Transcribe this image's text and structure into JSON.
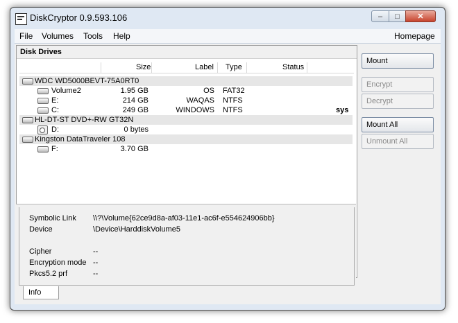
{
  "window": {
    "title": "DiskCryptor 0.9.593.106",
    "controls": {
      "minimize": "–",
      "maximize": "□",
      "close": "✕"
    }
  },
  "menu": {
    "items": [
      "File",
      "Volumes",
      "Tools",
      "Help"
    ],
    "homepage": "Homepage"
  },
  "drives": {
    "title": "Disk Drives",
    "columns": {
      "name": "",
      "size": "Size",
      "label": "Label",
      "type": "Type",
      "status": "Status"
    },
    "rows": [
      {
        "kind": "device",
        "icon": "hard-disk-icon",
        "name": "WDC WD5000BEVT-75A0RT0",
        "size": "",
        "label": "",
        "type": "",
        "status": ""
      },
      {
        "kind": "volume",
        "icon": "hard-disk-icon",
        "name": "Volume2",
        "size": "1.95 GB",
        "label": "OS",
        "type": "FAT32",
        "status": ""
      },
      {
        "kind": "volume",
        "icon": "hard-disk-icon",
        "name": "E:",
        "size": "214 GB",
        "label": "WAQAS",
        "type": "NTFS",
        "status": ""
      },
      {
        "kind": "volume",
        "icon": "hard-disk-icon",
        "name": "C:",
        "size": "249 GB",
        "label": "WINDOWS",
        "type": "NTFS",
        "status": "sys"
      },
      {
        "kind": "device",
        "icon": "hard-disk-icon",
        "name": "HL-DT-ST DVD+-RW GT32N",
        "size": "",
        "label": "",
        "type": "",
        "status": ""
      },
      {
        "kind": "volume",
        "icon": "cd-drive-icon",
        "name": "D:",
        "size": "0 bytes",
        "label": "",
        "type": "",
        "status": ""
      },
      {
        "kind": "device",
        "icon": "hard-disk-icon",
        "name": "Kingston DataTraveler 108",
        "size": "",
        "label": "",
        "type": "",
        "status": ""
      },
      {
        "kind": "volume",
        "icon": "hard-disk-icon",
        "name": "F:",
        "size": "3.70 GB",
        "label": "",
        "type": "",
        "status": ""
      }
    ]
  },
  "info": {
    "symbolic_link_label": "Symbolic Link",
    "symbolic_link_value": "\\\\?\\Volume{62ce9d8a-af03-11e1-ac6f-e554624906bb}",
    "device_label": "Device",
    "device_value": "\\Device\\HarddiskVolume5",
    "cipher_label": "Cipher",
    "cipher_value": "--",
    "encryption_mode_label": "Encryption mode",
    "encryption_mode_value": "--",
    "pkcs_label": "Pkcs5.2 prf",
    "pkcs_value": "--",
    "tab_label": "Info"
  },
  "actions": {
    "mount": "Mount",
    "encrypt": "Encrypt",
    "decrypt": "Decrypt",
    "mount_all": "Mount All",
    "unmount_all": "Unmount All"
  }
}
